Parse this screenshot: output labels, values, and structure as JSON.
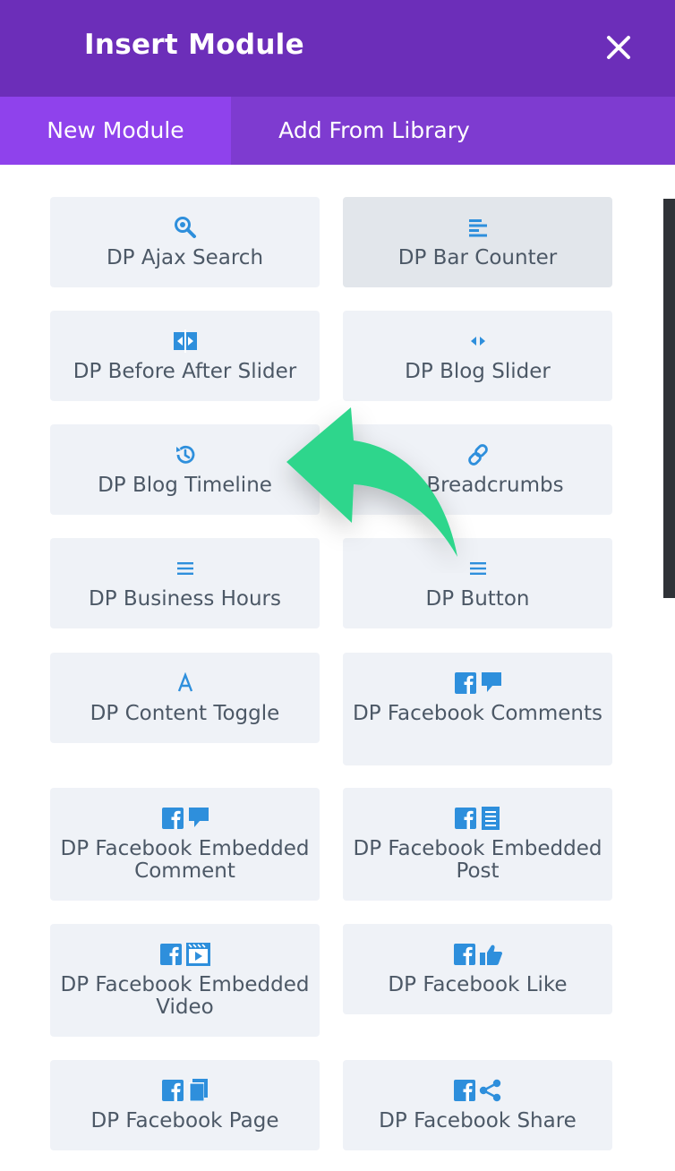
{
  "header": {
    "title": "Insert Module"
  },
  "tabs": {
    "new_module": "New Module",
    "add_from_library": "Add From Library"
  },
  "modules": [
    {
      "label": "DP Ajax Search",
      "icon": "search-icon"
    },
    {
      "label": "DP Bar Counter",
      "icon": "bar-lines-icon"
    },
    {
      "label": "DP Before After Slider",
      "icon": "before-after-icon"
    },
    {
      "label": "DP Blog Slider",
      "icon": "arrows-left-right-icon"
    },
    {
      "label": "DP Blog Timeline",
      "icon": "history-clock-icon"
    },
    {
      "label": "DP Breadcrumbs",
      "icon": "link-icon"
    },
    {
      "label": "DP Business Hours",
      "icon": "menu-lines-icon"
    },
    {
      "label": "DP Button",
      "icon": "menu-lines-icon"
    },
    {
      "label": "DP Content Toggle",
      "icon": "letter-a-icon"
    },
    {
      "label": "DP Facebook Comments",
      "icon": "facebook-comment-icon"
    },
    {
      "label": "DP Facebook Embedded Comment",
      "icon": "facebook-comment-icon"
    },
    {
      "label": "DP Facebook Embedded Post",
      "icon": "facebook-post-icon"
    },
    {
      "label": "DP Facebook Embedded Video",
      "icon": "facebook-video-icon"
    },
    {
      "label": "DP Facebook Like",
      "icon": "facebook-like-icon"
    },
    {
      "label": "DP Facebook Page",
      "icon": "facebook-page-icon"
    },
    {
      "label": "DP Facebook Share",
      "icon": "facebook-share-icon"
    }
  ],
  "colors": {
    "header_bg": "#6c2eb9",
    "tabs_bg": "#7e3bd0",
    "active_tab_bg": "#8f42ec",
    "card_bg": "#eff2f7",
    "icon_blue": "#2e8fdc",
    "arrow_green": "#2ed68c"
  }
}
